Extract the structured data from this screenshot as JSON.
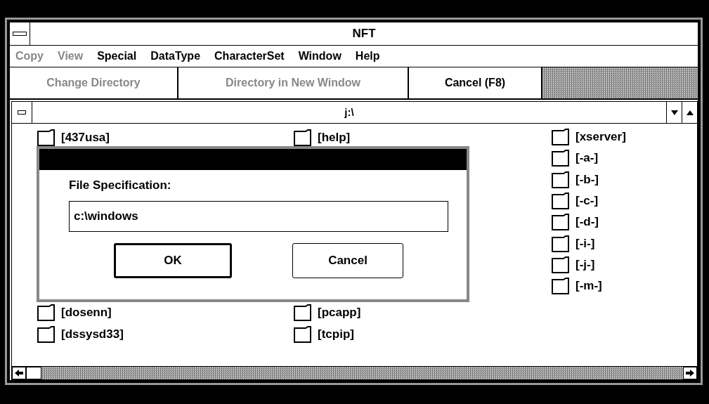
{
  "window": {
    "title": "NFT"
  },
  "menu": [
    {
      "label": "Copy",
      "disabled": true
    },
    {
      "label": "View",
      "disabled": true
    },
    {
      "label": "Special",
      "disabled": false
    },
    {
      "label": "DataType",
      "disabled": false
    },
    {
      "label": "CharacterSet",
      "disabled": false
    },
    {
      "label": "Window",
      "disabled": false
    },
    {
      "label": "Help",
      "disabled": false
    }
  ],
  "toolbar": [
    {
      "label": "Change Directory",
      "disabled": true
    },
    {
      "label": "Directory in New Window",
      "disabled": true
    },
    {
      "label": "Cancel (F8)",
      "disabled": false
    }
  ],
  "directory_window": {
    "title": "j:\\",
    "columns": [
      [
        {
          "kind": "folder",
          "name": "[437usa]"
        },
        {
          "kind": "covered"
        },
        {
          "kind": "covered"
        },
        {
          "kind": "covered"
        },
        {
          "kind": "covered"
        },
        {
          "kind": "covered"
        },
        {
          "kind": "covered"
        },
        {
          "kind": "covered"
        },
        {
          "kind": "folder",
          "name": "[dosenn]"
        },
        {
          "kind": "folder",
          "name": "[dssysd33]"
        }
      ],
      [
        {
          "kind": "folder",
          "name": "[help]"
        },
        {
          "kind": "covered"
        },
        {
          "kind": "covered"
        },
        {
          "kind": "covered"
        },
        {
          "kind": "covered"
        },
        {
          "kind": "covered"
        },
        {
          "kind": "covered"
        },
        {
          "kind": "covered"
        },
        {
          "kind": "folder",
          "name": "[pcapp]"
        },
        {
          "kind": "folder",
          "name": "[tcpip]"
        }
      ],
      [
        {
          "kind": "folder",
          "name": "[xserver]"
        },
        {
          "kind": "folder",
          "name": "[-a-]"
        },
        {
          "kind": "folder",
          "name": "[-b-]"
        },
        {
          "kind": "folder",
          "name": "[-c-]"
        },
        {
          "kind": "folder",
          "name": "[-d-]"
        },
        {
          "kind": "folder",
          "name": "[-i-]"
        },
        {
          "kind": "folder",
          "name": "[-j-]"
        },
        {
          "kind": "folder",
          "name": "[-m-]"
        }
      ]
    ]
  },
  "dialog": {
    "label": "File Specification:",
    "value": "c:\\windows",
    "buttons": [
      {
        "label": "OK",
        "default": true
      },
      {
        "label": "Cancel",
        "default": false
      }
    ]
  }
}
